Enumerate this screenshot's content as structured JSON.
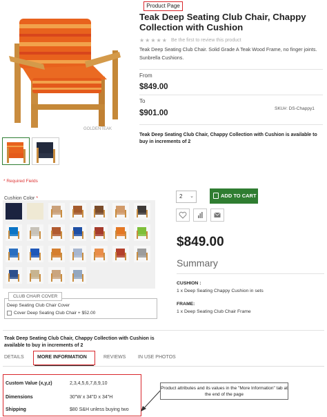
{
  "page": {
    "callout_label": "Product Page",
    "required_fields": "* Required Fields"
  },
  "product": {
    "title": "Teak Deep Seating Club Chair, Chappy Collection with Cushion",
    "review_link": "Be the first to review this product",
    "description": "Teak Deep Seating Club Chair. Solid Grade A Teak Wood Frame, no finger joints. Sunbrella Cushions.",
    "from_label": "From",
    "from_price": "$849.00",
    "to_label": "To",
    "to_price": "$901.00",
    "sku": "SKU#:  DS-Chappy1",
    "buy_note": "Teak Deep Seating Club Chair, Chappy Collection with Cushion is available to buy in increments of 2",
    "watermark": "GOLDENTEAK"
  },
  "options": {
    "cushion_color_label": "Cushion Color",
    "swatch_colors": [
      [
        "#1b2340",
        "#efe9d4",
        "#caa17a",
        "#a45a2c",
        "#7a4b2a",
        "#d19a6a",
        "#3e3a38"
      ],
      [
        "#0b74c5",
        "#c7c2b8",
        "#b15a2f",
        "#1f4fa3",
        "#a53b2b",
        "#e37724",
        "#7fbf3a"
      ],
      [
        "#2a6fc0",
        "#1f57b8",
        "#d57e2e",
        "#a7b6cf",
        "#e98d49",
        "#b3412c",
        "#9c9c9c"
      ],
      [
        "#2d4f8d",
        "#c7b490",
        "#caa57f",
        "#94a7bf"
      ]
    ],
    "group_tab": "CLUB CHAIR COVER",
    "group_title": "Deep Seating Club Chair Cover",
    "group_option": "Cover Deep Seating Club Chair + $52.00"
  },
  "purchase": {
    "qty": "2",
    "add_to_cart": "ADD TO CART",
    "price": "$849.00",
    "summary_title": "Summary",
    "cushion_label": "CUSHION :",
    "cushion_value": "1 x Deep Seating Chappy Cushion in sets",
    "frame_label": "FRAME:",
    "frame_value": "1 x Deep Seating Club Chair Frame"
  },
  "tabs": {
    "buy_note": "Teak Deep Seating Club Chair, Chappy Collection with Cushion is available to buy in increments of 2",
    "details": "DETAILS",
    "more_info": "MORE INFORMATION",
    "reviews": "REVIEWS",
    "in_use": "IN USE PHOTOS"
  },
  "attributes": [
    {
      "key": "Custom Value (x,y,z)",
      "value": "2,3,4,5,6,7,8,9,10"
    },
    {
      "key": "Dimensions",
      "value": "30\"W x 34\"D x 34\"H"
    },
    {
      "key": "Shipping",
      "value": "$80 S&H unless buying two"
    }
  ],
  "annotation": "Product attributes and its values in the \"More Information\" tab at the end of the page",
  "colors": {
    "accent_red": "#d9262b",
    "cart_green": "#2f7d31",
    "cushion_orange": "#e8621d",
    "teak": "#c98c3e"
  }
}
